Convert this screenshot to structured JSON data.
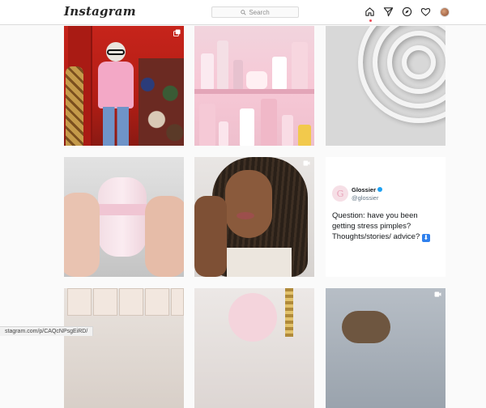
{
  "header": {
    "logo": "Instagram",
    "search_placeholder": "Search",
    "nav_icons": [
      "home-icon",
      "direct-icon",
      "explore-icon",
      "activity-icon",
      "profile-avatar"
    ]
  },
  "grid": {
    "posts": [
      {
        "name": "post-pink-outfit-red-room",
        "type": "carousel"
      },
      {
        "name": "post-glossier-shelf",
        "type": "image"
      },
      {
        "name": "post-white-curves",
        "type": "image"
      },
      {
        "name": "post-pink-deodorant",
        "type": "image"
      },
      {
        "name": "post-lip-application",
        "type": "video"
      },
      {
        "name": "post-tweet-card",
        "type": "image"
      },
      {
        "name": "post-boxes",
        "type": "image"
      },
      {
        "name": "post-pink-bag",
        "type": "image"
      },
      {
        "name": "post-blanket",
        "type": "video"
      }
    ],
    "tweet": {
      "account_name": "Glossier",
      "handle": "@glossier",
      "text": "Question: have you been getting stress pimples? Thoughts/stories/ advice?",
      "emoji": "⬇"
    }
  },
  "status_bar": {
    "url": "stagram.com/p/CAQcNPsgEiRD/"
  },
  "colors": {
    "accent_dot": "#ed4956",
    "verified": "#1da1f2"
  }
}
